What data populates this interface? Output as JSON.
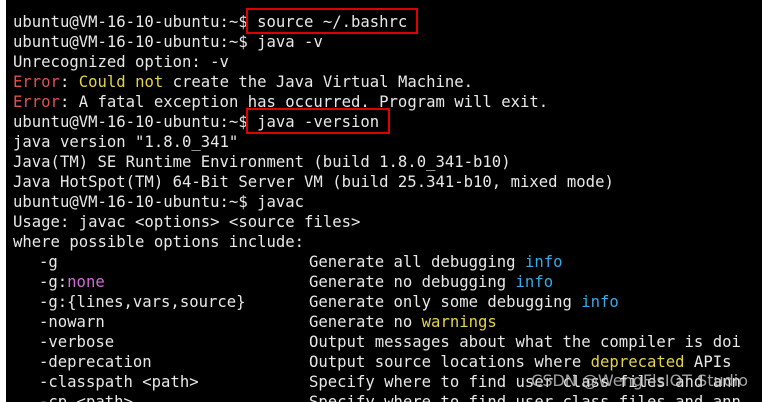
{
  "terminal": {
    "lines": [
      {
        "prompt": "ubuntu@VM-16-10-ubuntu:~$ ",
        "command": "source ~/.bashrc",
        "highlighted": true
      },
      {
        "prompt": "ubuntu@VM-16-10-ubuntu:~$ ",
        "command": "java -v",
        "highlighted": false
      },
      {
        "segments": [
          {
            "text": "Unrecognized option: -v",
            "color": "white"
          }
        ]
      },
      {
        "segments": [
          {
            "text": "Error",
            "color": "red"
          },
          {
            "text": ": ",
            "color": "white"
          },
          {
            "text": "Could not",
            "color": "yellow"
          },
          {
            "text": " create the Java Virtual Machine.",
            "color": "white"
          }
        ]
      },
      {
        "segments": [
          {
            "text": "Error",
            "color": "red"
          },
          {
            "text": ": A fatal exception has occurred. Program will exit.",
            "color": "white"
          }
        ]
      },
      {
        "prompt": "ubuntu@VM-16-10-ubuntu:~$ ",
        "command": "java -version",
        "highlighted": true
      },
      {
        "segments": [
          {
            "text": "java version \"1.8.0_341\"",
            "color": "white"
          }
        ]
      },
      {
        "segments": [
          {
            "text": "Java(TM) SE Runtime Environment (build 1.8.0_341-b10)",
            "color": "white"
          }
        ]
      },
      {
        "segments": [
          {
            "text": "Java HotSpot(TM) 64-Bit Server VM (build 25.341-b10, mixed mode)",
            "color": "white"
          }
        ]
      },
      {
        "prompt": "ubuntu@VM-16-10-ubuntu:~$ ",
        "command": "javac",
        "highlighted": false
      },
      {
        "segments": [
          {
            "text": "Usage: javac <options> <source files>",
            "color": "white"
          }
        ]
      },
      {
        "segments": [
          {
            "text": "where possible options include:",
            "color": "white"
          }
        ]
      }
    ],
    "options": [
      {
        "name": [
          {
            "text": "-g",
            "color": "white"
          }
        ],
        "desc": [
          {
            "text": "Generate all debugging ",
            "color": "white"
          },
          {
            "text": "info",
            "color": "cyan"
          }
        ]
      },
      {
        "name": [
          {
            "text": "-g:",
            "color": "white"
          },
          {
            "text": "none",
            "color": "magenta"
          }
        ],
        "desc": [
          {
            "text": "Generate no debugging ",
            "color": "white"
          },
          {
            "text": "info",
            "color": "cyan"
          }
        ]
      },
      {
        "name": [
          {
            "text": "-g:{lines,vars,source}",
            "color": "white"
          }
        ],
        "desc": [
          {
            "text": "Generate only some debugging ",
            "color": "white"
          },
          {
            "text": "info",
            "color": "cyan"
          }
        ]
      },
      {
        "name": [
          {
            "text": "-nowarn",
            "color": "white"
          }
        ],
        "desc": [
          {
            "text": "Generate no ",
            "color": "white"
          },
          {
            "text": "warnings",
            "color": "yellow"
          }
        ]
      },
      {
        "name": [
          {
            "text": "-verbose",
            "color": "white"
          }
        ],
        "desc": [
          {
            "text": "Output messages about what the compiler is doi",
            "color": "white"
          }
        ]
      },
      {
        "name": [
          {
            "text": "-deprecation",
            "color": "white"
          }
        ],
        "desc": [
          {
            "text": "Output source locations where ",
            "color": "white"
          },
          {
            "text": "deprecated",
            "color": "yellow"
          },
          {
            "text": " APIs",
            "color": "white"
          }
        ]
      },
      {
        "name": [
          {
            "text": "-classpath <path>",
            "color": "white"
          }
        ],
        "desc": [
          {
            "text": "Specify where to find user class files and ann",
            "color": "white"
          }
        ]
      },
      {
        "name": [
          {
            "text": "-cp <path>",
            "color": "white"
          }
        ],
        "desc": [
          {
            "text": "Specify where to find user class files and ann",
            "color": "white"
          }
        ]
      }
    ]
  },
  "watermark": "CSDN @WengFlsIOT Studio",
  "colors": {
    "background": "#000000",
    "text": "#e8e8e8",
    "highlight_box": "#e00000",
    "red": "#e05050",
    "yellow": "#e6d24a",
    "magenta": "#d36ad6",
    "cyan": "#38a9e6"
  }
}
